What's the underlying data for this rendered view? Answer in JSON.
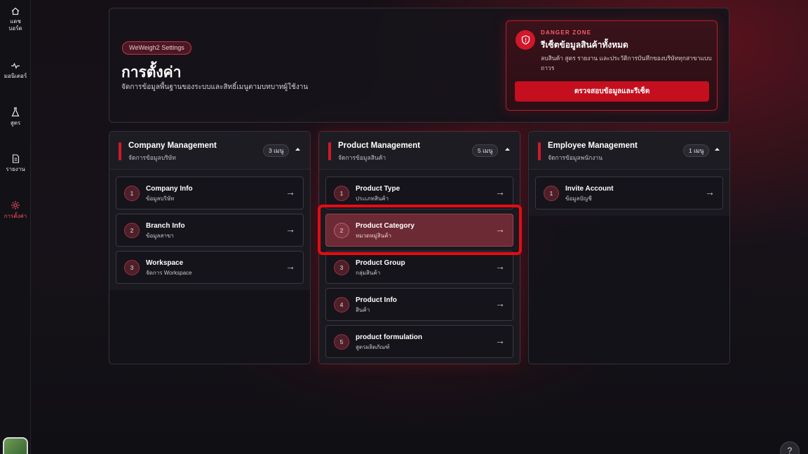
{
  "sidebar": {
    "items": [
      {
        "label": "แดช\nบอร์ด",
        "icon": "home-icon"
      },
      {
        "label": "มอนิเตอร์",
        "icon": "monitor-wave-icon"
      },
      {
        "label": "สูตร",
        "icon": "flask-icon"
      },
      {
        "label": "รายงาน",
        "icon": "document-icon"
      },
      {
        "label": "การตั้งค่า",
        "icon": "gear-icon",
        "active": true
      }
    ]
  },
  "header": {
    "pill": "WeWeigh2 Settings",
    "title": "การตั้งค่า",
    "subtitle": "จัดการข้อมูลพื้นฐานของระบบและสิทธิ์เมนูตามบทบาทผู้ใช้งาน"
  },
  "danger": {
    "label": "DANGER ZONE",
    "title": "รีเซ็ตข้อมูลสินค้าทั้งหมด",
    "description": "ลบสินค้า สูตร รายงาน และประวัติการบันทึกของบริษัททุกสาขาแบบถาวร",
    "button": "ตรวจสอบข้อมูลและรีเซ็ต"
  },
  "columns": [
    {
      "title": "Company Management",
      "subtitle": "จัดการข้อมูลบริษัท",
      "badge": "3 เมนู",
      "items": [
        {
          "num": "1",
          "title": "Company Info",
          "subtitle": "ข้อมูลบริษัท"
        },
        {
          "num": "2",
          "title": "Branch Info",
          "subtitle": "ข้อมูลสาขา"
        },
        {
          "num": "3",
          "title": "Workspace",
          "subtitle": "จัดการ Workspace"
        }
      ]
    },
    {
      "title": "Product Management",
      "subtitle": "จัดการข้อมูลสินค้า",
      "badge": "5 เมนู",
      "items": [
        {
          "num": "1",
          "title": "Product Type",
          "subtitle": "ประเภทสินค้า"
        },
        {
          "num": "2",
          "title": "Product Category",
          "subtitle": "หมวดหมู่สินค้า",
          "selected": true
        },
        {
          "num": "3",
          "title": "Product Group",
          "subtitle": "กลุ่มสินค้า"
        },
        {
          "num": "4",
          "title": "Product Info",
          "subtitle": "สินค้า"
        },
        {
          "num": "5",
          "title": "product formulation",
          "subtitle": "สูตรผลิตภัณฑ์"
        }
      ]
    },
    {
      "title": "Employee Management",
      "subtitle": "จัดการข้อมูลพนักงาน",
      "badge": "1 เมนู",
      "items": [
        {
          "num": "1",
          "title": "Invite Account",
          "subtitle": "ข้อมูลบัญชี"
        }
      ]
    }
  ],
  "arrow_glyph": "→",
  "help_glyph": "?",
  "colors": {
    "accent": "#d0192b",
    "danger": "#c50f1f",
    "highlight": "#e50c12"
  }
}
